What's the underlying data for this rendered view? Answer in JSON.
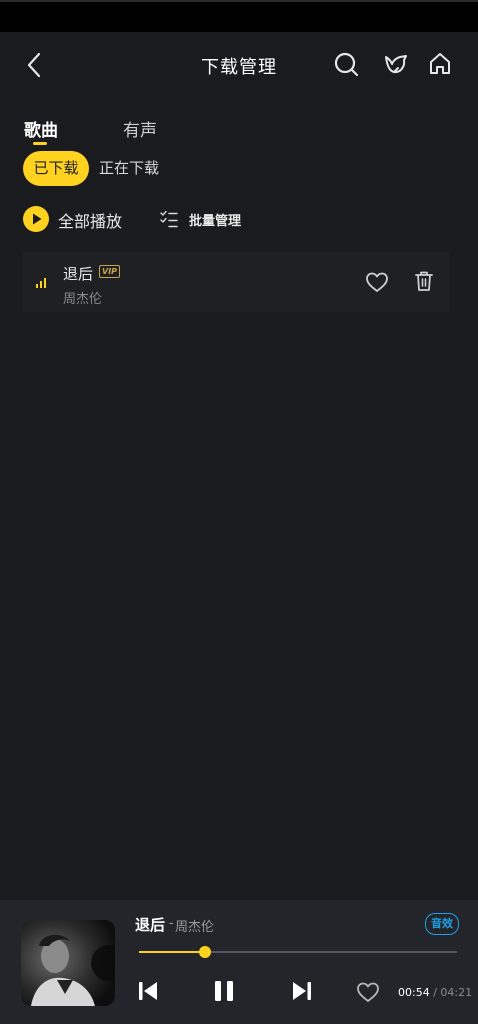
{
  "header": {
    "title": "下载管理"
  },
  "tabs": [
    {
      "label": "歌曲"
    },
    {
      "label": "有声"
    }
  ],
  "subtabs": [
    {
      "label": "已下载"
    },
    {
      "label": "正在下载"
    }
  ],
  "actions": {
    "play_all": "全部播放",
    "batch_manage": "批量管理"
  },
  "songs": [
    {
      "title": "退后",
      "badge": "VIP",
      "artist": "周杰伦"
    }
  ],
  "player": {
    "title": "退后",
    "separator": "-",
    "artist": "周杰伦",
    "sound_effect": "音效",
    "current_time": "00:54",
    "time_separator": "/",
    "total_time": "04:21",
    "progress_fraction": 0.207
  },
  "colors": {
    "accent": "#ffd21f",
    "background": "#1a1b1e",
    "badge_blue": "#1ea1e8"
  },
  "icons": [
    "back-icon",
    "search-icon",
    "bird-icon",
    "home-icon",
    "play-icon",
    "list-check-icon",
    "equalizer-icon",
    "heart-icon",
    "trash-icon",
    "previous-icon",
    "pause-icon",
    "next-icon"
  ]
}
